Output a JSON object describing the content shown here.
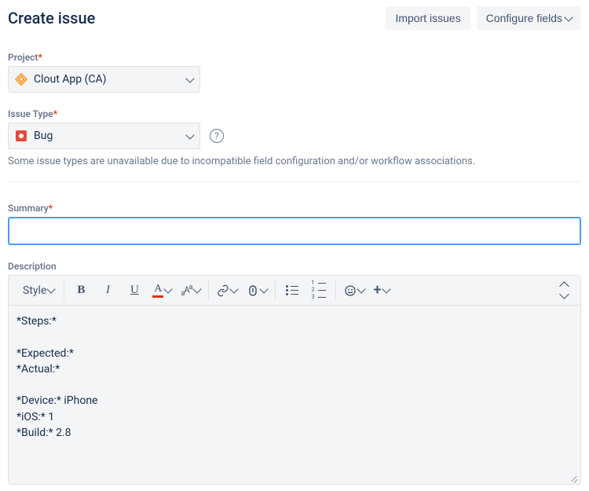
{
  "header": {
    "title": "Create issue",
    "import_label": "Import issues",
    "configure_label": "Configure fields"
  },
  "project": {
    "label": "Project",
    "value": "Clout App (CA)"
  },
  "issueType": {
    "label": "Issue Type",
    "value": "Bug",
    "helper": "Some issue types are unavailable due to incompatible field configuration and/or workflow associations."
  },
  "summary": {
    "label": "Summary",
    "value": ""
  },
  "description": {
    "label": "Description",
    "style_label": "Style",
    "content": "*Steps:*\n\n*Expected:*\n*Actual:*\n\n*Device:* iPhone\n*iOS:* 1\n*Build:* 2.8"
  }
}
